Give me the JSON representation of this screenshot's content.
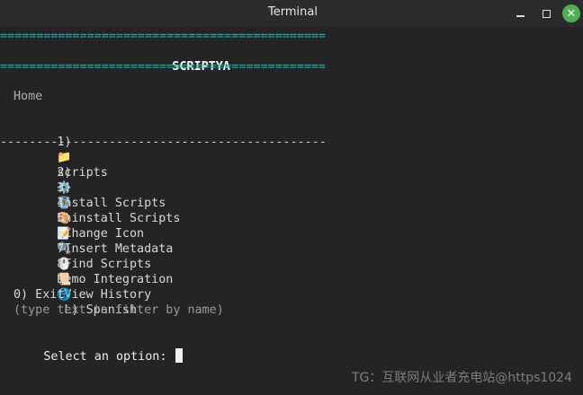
{
  "window": {
    "title": "Terminal",
    "controls": {
      "minimize_icon": "minimize-icon",
      "maximize_icon": "maximize-icon",
      "close_icon": "close-icon",
      "close_symbol": "✕",
      "close_color": "#4caf50"
    }
  },
  "terminal": {
    "rule_equals": "=============================================",
    "header_title": "SCRIPTYA",
    "location": "Home",
    "first_option": {
      "number": "1)",
      "icon": "📁",
      "label": "scripts"
    },
    "rule_dashes": "---------------------------------------------",
    "options": [
      {
        "number": "2)",
        "icon": "⚙️",
        "label": "Install Scripts"
      },
      {
        "number": "3)",
        "icon": "🗑️",
        "label": "Uninstall Scripts"
      },
      {
        "number": "4)",
        "icon": "🎨",
        "label": " Change Icon"
      },
      {
        "number": "5)",
        "icon": "📝",
        "label": " Insert Metadata"
      },
      {
        "number": "6)",
        "icon": "🔍",
        "label": " Find Scripts"
      },
      {
        "number": "7)",
        "icon": "🖱️",
        "label": "Nemo Integration"
      },
      {
        "number": "8)",
        "icon": "📜",
        "label": " View History"
      },
      {
        "number": "9)",
        "icon": "🌐",
        "label": " L) Spanish"
      }
    ],
    "exit_option": "0) Exit",
    "filter_hint": "(type text to filter by name)",
    "prompt": "Select an option: "
  },
  "watermark": "TG：互联网从业者充电站@https1024",
  "colors": {
    "background": "#242427",
    "rule_accent": "#19b3a6",
    "text": "#d6d6d6"
  }
}
